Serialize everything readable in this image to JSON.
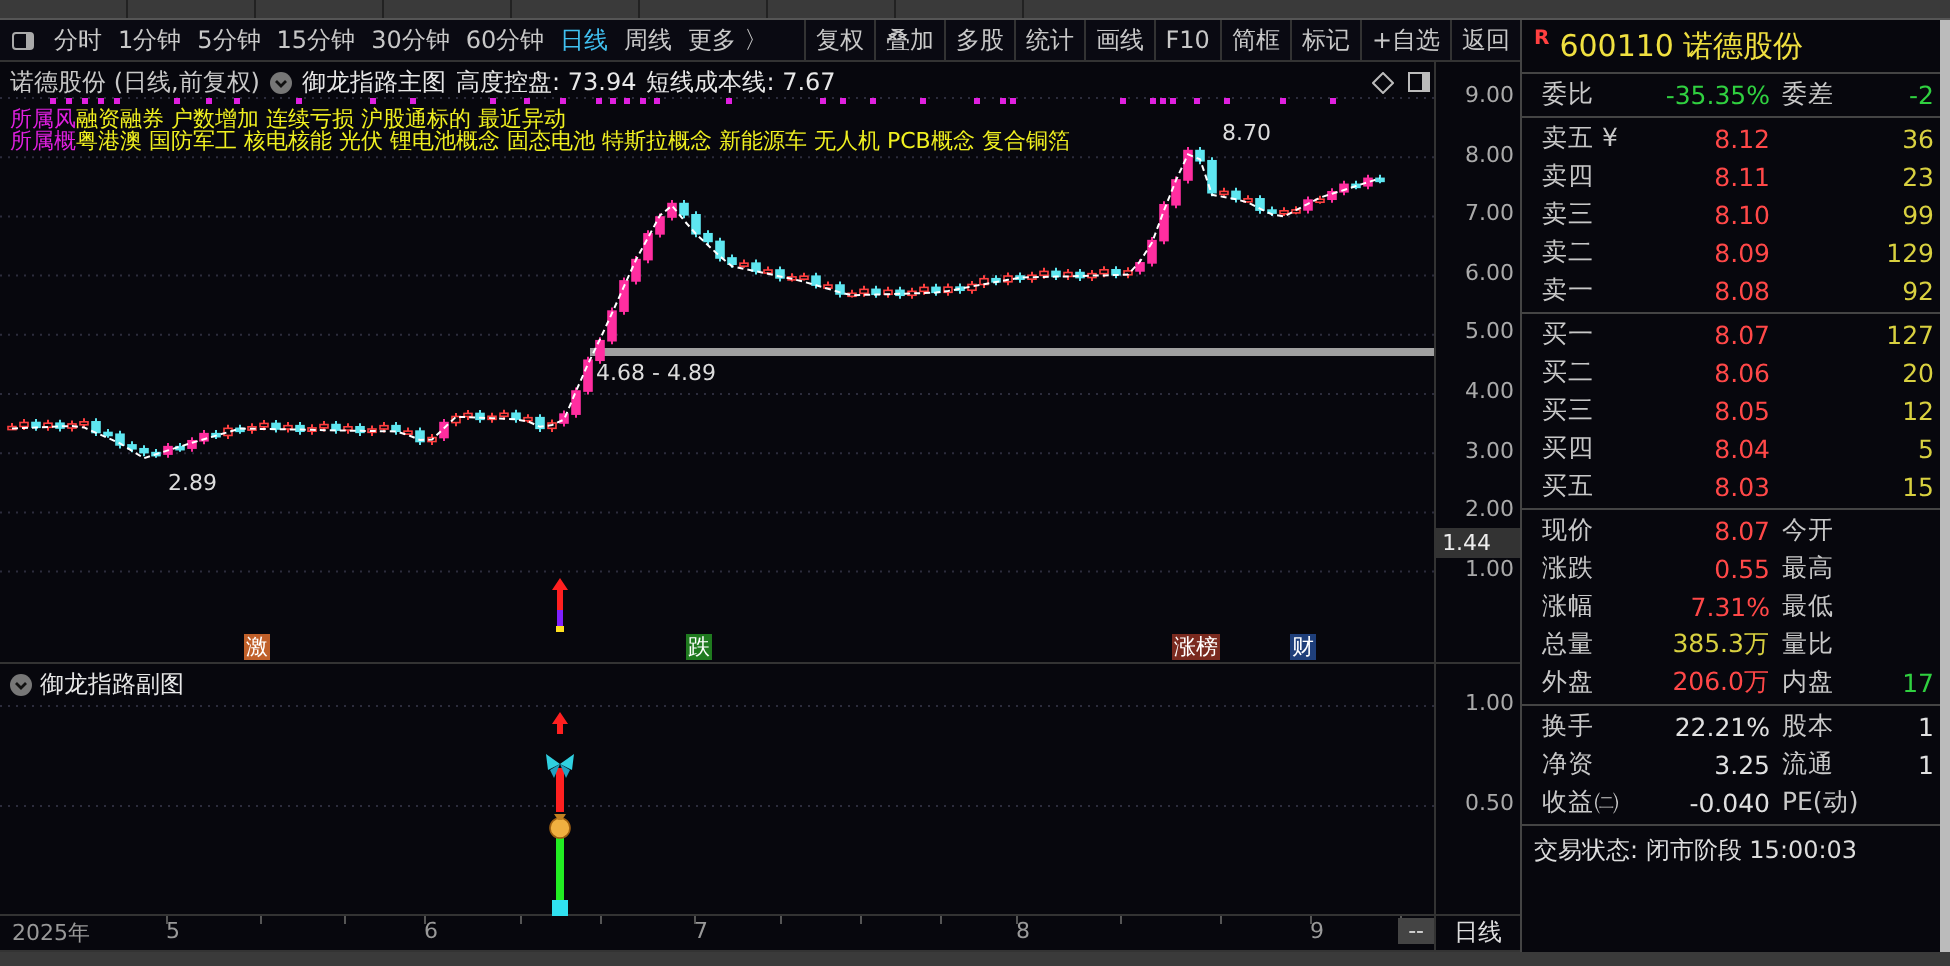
{
  "toolbar": {
    "periods": [
      {
        "label": "分时",
        "selected": false
      },
      {
        "label": "1分钟",
        "selected": false
      },
      {
        "label": "5分钟",
        "selected": false
      },
      {
        "label": "15分钟",
        "selected": false
      },
      {
        "label": "30分钟",
        "selected": false
      },
      {
        "label": "60分钟",
        "selected": false
      },
      {
        "label": "日线",
        "selected": true
      },
      {
        "label": "周线",
        "selected": false
      },
      {
        "label": "更多 〉",
        "selected": false
      }
    ],
    "buttons": [
      "复权",
      "叠加",
      "多股",
      "统计",
      "画线",
      "F10",
      "简框",
      "标记",
      "+自选",
      "返回"
    ]
  },
  "main_chart": {
    "stock": "诺德股份 (日线,前复权)",
    "indicator": "御龙指路主图",
    "readings": [
      "高度控盘: 73.94",
      "短线成本线: 7.67"
    ],
    "concept_lines": [
      {
        "label": "所属风",
        "tags": "融资融券 户数增加 连续亏损 沪股通标的 最近异动"
      },
      {
        "label": "所属概",
        "tags": "粤港澳 国防军工 核电核能 光伏 锂电池概念 固态电池 特斯拉概念 新能源车 无人机 PCB概念 复合铜箔"
      }
    ],
    "annotations": [
      "8.70",
      "2.89",
      "4.68 - 4.89"
    ],
    "price_ticks": [
      "9.00",
      "8.00",
      "7.00",
      "6.00",
      "5.00",
      "4.00",
      "3.00",
      "2.00",
      "1.00"
    ],
    "value_tag": "1.44",
    "signals": [
      {
        "text": "激",
        "color": "#c0602a"
      },
      {
        "text": "跌",
        "color": "#1f7a1f"
      },
      {
        "text": "涨榜",
        "color": "#7a2a1f"
      },
      {
        "text": "财",
        "color": "#1f3f7a"
      }
    ]
  },
  "sub_chart": {
    "title": "御龙指路副图",
    "ticks": [
      "1.00",
      "0.50"
    ]
  },
  "time_axis": {
    "labels": [
      "2025年",
      "5",
      "6",
      "7",
      "8",
      "9"
    ],
    "end": "--",
    "period": "日线"
  },
  "quote": {
    "badge": "R",
    "code": "600110",
    "name": "诺德股份",
    "ratio": {
      "label": "委比",
      "value": "-35.35%",
      "label2": "委差",
      "value2": "-2"
    },
    "asks": [
      {
        "label": "卖五 ¥",
        "price": "8.12",
        "volume": "36"
      },
      {
        "label": "卖四",
        "price": "8.11",
        "volume": "23"
      },
      {
        "label": "卖三",
        "price": "8.10",
        "volume": "99"
      },
      {
        "label": "卖二",
        "price": "8.09",
        "volume": "129"
      },
      {
        "label": "卖一",
        "price": "8.08",
        "volume": "92"
      }
    ],
    "bids": [
      {
        "label": "买一",
        "price": "8.07",
        "volume": "127"
      },
      {
        "label": "买二",
        "price": "8.06",
        "volume": "20"
      },
      {
        "label": "买三",
        "price": "8.05",
        "volume": "12"
      },
      {
        "label": "买四",
        "price": "8.04",
        "volume": "5"
      },
      {
        "label": "买五",
        "price": "8.03",
        "volume": "15"
      }
    ],
    "stats": [
      {
        "label": "现价",
        "value": "8.07",
        "color": "#ff4848",
        "label2": "今开"
      },
      {
        "label": "涨跌",
        "value": "0.55",
        "color": "#ff4848",
        "label2": "最高"
      },
      {
        "label": "涨幅",
        "value": "7.31%",
        "color": "#ff4848",
        "label2": "最低"
      },
      {
        "label": "总量",
        "value": "385.3万",
        "color": "#d8d040",
        "label2": "量比"
      },
      {
        "label": "外盘",
        "value": "206.0万",
        "color": "#ff4848",
        "label2": "内盘",
        "right": {
          "value": "17",
          "color": "#30d040"
        }
      }
    ],
    "fundamentals": [
      {
        "label": "换手",
        "value": "22.21%",
        "color": "#e0e0e0",
        "label2": "股本",
        "right": {
          "value": "1",
          "color": "#e0e0e0"
        }
      },
      {
        "label": "净资",
        "value": "3.25",
        "color": "#e0e0e0",
        "label2": "流通",
        "right": {
          "value": "1",
          "color": "#e0e0e0"
        }
      },
      {
        "label": "收益㈡",
        "value": "-0.040",
        "color": "#e0e0e0",
        "label2": "PE(动)"
      }
    ],
    "status": "交易状态: 闭市阶段 15:00:03"
  }
}
